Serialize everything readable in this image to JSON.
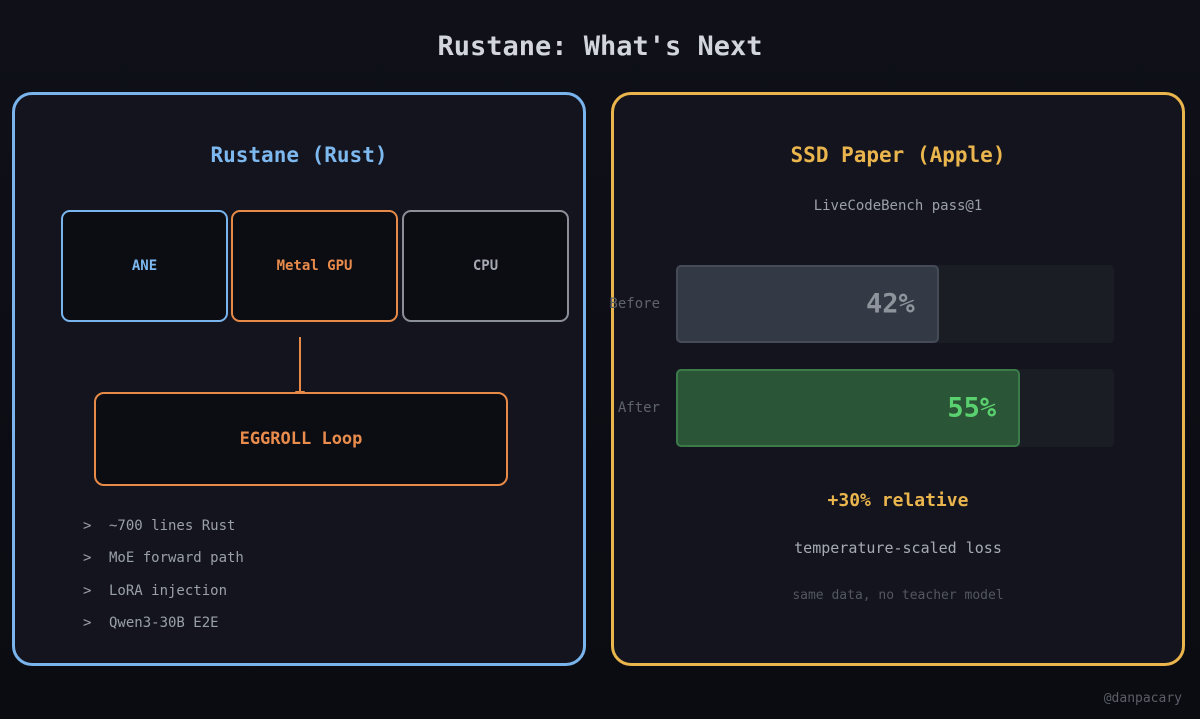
{
  "title": "Rustane: What's Next",
  "left_panel": {
    "title": "Rustane (Rust)",
    "units": [
      {
        "label": "ANE"
      },
      {
        "label": "Metal GPU"
      },
      {
        "label": "CPU"
      }
    ],
    "loop_label": "EGGROLL Loop",
    "bullet_marker": ">",
    "bullets": [
      "~700 lines Rust",
      "MoE forward path",
      "LoRA injection",
      "Qwen3-30B E2E"
    ]
  },
  "right_panel": {
    "title": "SSD Paper (Apple)",
    "subtitle": "LiveCodeBench pass@1",
    "bars": [
      {
        "label": "Before",
        "value": 42,
        "display": "42%"
      },
      {
        "label": "After",
        "value": 55,
        "display": "55%"
      }
    ],
    "scale_max": 70,
    "relative": "+30% relative",
    "method": "temperature-scaled loss",
    "note": "same data, no teacher model"
  },
  "handle": "@danpacary",
  "colors": {
    "ane": "#79b4ec",
    "metal_gpu": "#e78a47",
    "cpu": "#8b8f97",
    "ssd_accent": "#e9b54c",
    "after_green": "#5ad16f"
  }
}
